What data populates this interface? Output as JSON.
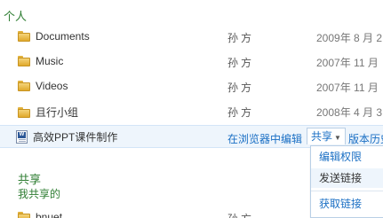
{
  "personal": {
    "title": "个人",
    "items": [
      {
        "name": "Documents",
        "owner": "孙方",
        "date": "2009年 8 月 2",
        "icon": "folder-icon"
      },
      {
        "name": "Music",
        "owner": "孙方",
        "date": "2007年 11 月",
        "icon": "folder-icon"
      },
      {
        "name": "Videos",
        "owner": "孙方",
        "date": "2007年 11 月",
        "icon": "folder-icon"
      },
      {
        "name": "且行小组",
        "owner": "孙方",
        "date": "2008年 4 月 3",
        "icon": "folder-icon"
      },
      {
        "name": "高效PPT课件制作",
        "icon": "word-document-icon"
      }
    ]
  },
  "selected_row": {
    "edit_in_browser": "在浏览器中编辑",
    "share": "共享",
    "version_history": "版本历史"
  },
  "share_menu": {
    "items": [
      "编辑权限",
      "发送链接",
      "获取链接"
    ]
  },
  "shared": {
    "title": "共享",
    "subtitle": "我共享的",
    "items": [
      {
        "name": "bnuet",
        "owner": "孙方"
      }
    ]
  },
  "colors": {
    "section_green": "#2e7d32",
    "link_blue": "#1a6fc4",
    "selected_bg": "#eef5fc"
  }
}
